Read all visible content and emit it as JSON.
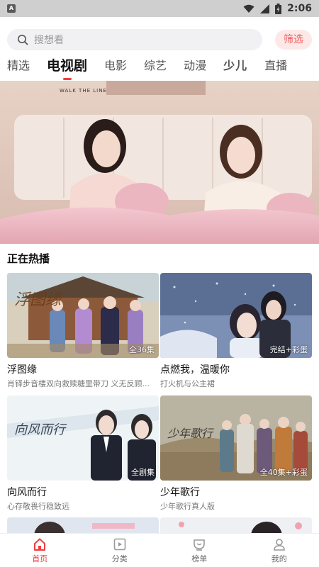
{
  "status_bar": {
    "time": "2:06",
    "notification_icon": "A"
  },
  "search": {
    "placeholder": "搜想看",
    "filter_label": "筛选"
  },
  "tabs": [
    {
      "label": "精选",
      "active": false
    },
    {
      "label": "电视剧",
      "active": true
    },
    {
      "label": "电影",
      "active": false
    },
    {
      "label": "综艺",
      "active": false
    },
    {
      "label": "动漫",
      "active": false
    },
    {
      "label": "少儿",
      "active": false
    },
    {
      "label": "直播",
      "active": false
    }
  ],
  "banner": {
    "art_subtitle": "WALK THE LINE"
  },
  "section": {
    "title": "正在热播"
  },
  "cards": [
    {
      "title": "浮图缘",
      "desc": "肖铎步音楼双向救赎糖里带刀 义无反顾...",
      "badge": "全36集",
      "art_text": "浮图缘"
    },
    {
      "title": "点燃我，温暖你",
      "desc": "打火机与公主裙",
      "badge": "完结+彩蛋",
      "art_text": ""
    },
    {
      "title": "向风而行",
      "desc": "心存敬畏行稳致远",
      "badge": "全剧集",
      "art_text": "向风而行"
    },
    {
      "title": "少年歌行",
      "desc": "少年歌行真人版",
      "badge": "全40集+彩蛋",
      "art_text": "少年歌行"
    }
  ],
  "bottom_nav": [
    {
      "label": "首页",
      "icon": "home-icon",
      "active": true
    },
    {
      "label": "分类",
      "icon": "category-icon",
      "active": false
    },
    {
      "label": "榜单",
      "icon": "ranking-icon",
      "active": false
    },
    {
      "label": "我的",
      "icon": "profile-icon",
      "active": false
    }
  ],
  "colors": {
    "accent": "#f23d3d",
    "filter_bg": "#fde8e8",
    "search_bg": "#f1f1f3"
  }
}
